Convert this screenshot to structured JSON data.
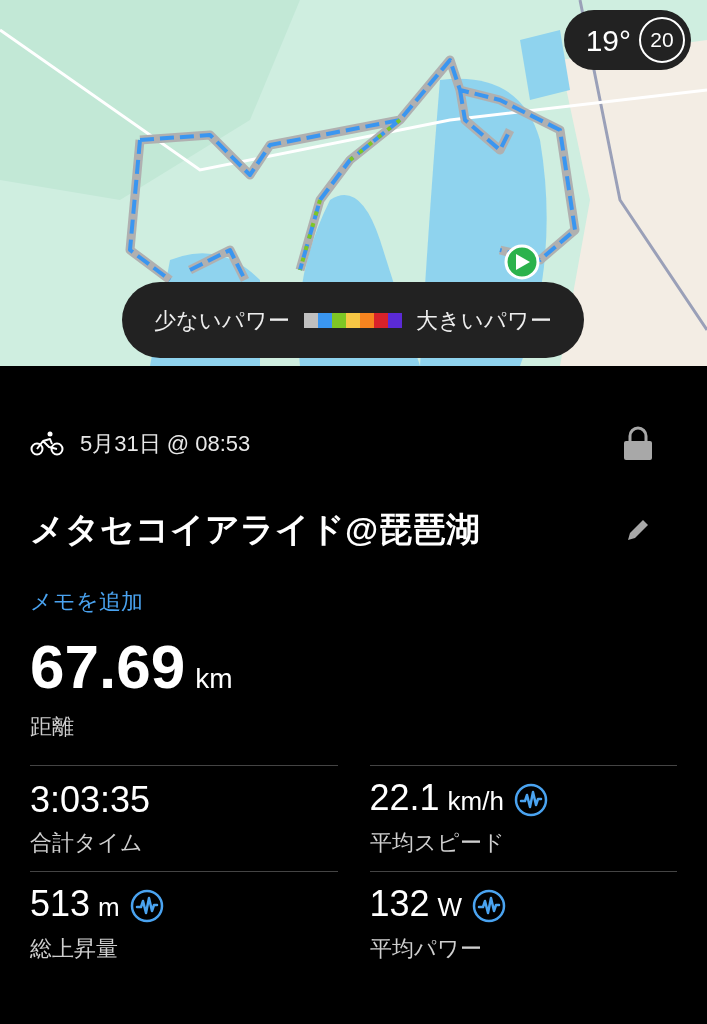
{
  "map": {
    "kind": "picture",
    "weather": {
      "temperature": "19°",
      "badge": "20"
    },
    "legend": {
      "low_label": "少ないパワー",
      "high_label": "大きいパワー",
      "swatches": [
        {
          "color": "#c0c0c0"
        },
        {
          "color": "#3a96f0"
        },
        {
          "color": "#7ec625"
        },
        {
          "color": "#f7c644"
        },
        {
          "color": "#f6841f"
        },
        {
          "color": "#d8222a"
        },
        {
          "color": "#5b2ad6"
        }
      ]
    }
  },
  "activity": {
    "date": "5月31日 @ 08:53",
    "locked": true,
    "title": "メタセコイアライド@琵琶湖",
    "add_note": "メモを追加"
  },
  "distance": {
    "value": "67.69",
    "unit": "km",
    "label": "距離"
  },
  "stats": [
    {
      "value": "3:03:35",
      "label": "合計タイム",
      "analysis": false
    },
    {
      "value": "22.1",
      "unit": "km/h",
      "label": "平均スピード",
      "analysis": true
    },
    {
      "value": "513",
      "unit": "m",
      "label": "総上昇量",
      "analysis": true
    },
    {
      "value": "132",
      "unit": "W",
      "label": "平均パワー",
      "analysis": true
    }
  ]
}
